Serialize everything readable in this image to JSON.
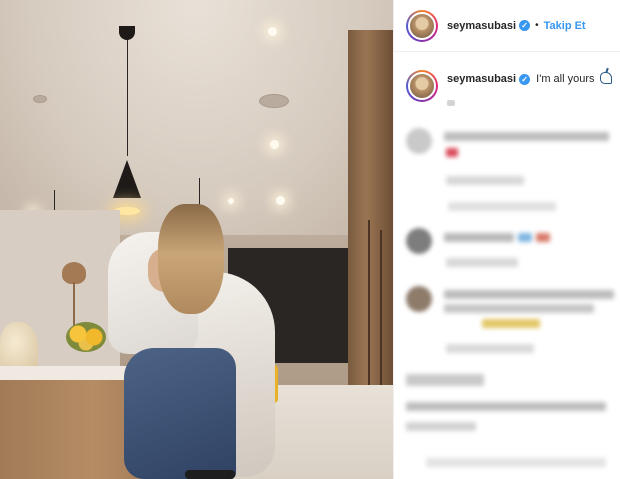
{
  "post": {
    "header": {
      "username": "seymasubasi",
      "verified_icon": "verified-badge-icon",
      "separator": "•",
      "follow_label": "Takip Et",
      "accent_color": "#3897f0"
    },
    "caption": {
      "username": "seymasubasi",
      "text": "I'm all yours",
      "emoji_icon": "unicorn-icon"
    },
    "photo": {
      "description_icon": "couple-kitchen-photo"
    },
    "comments_blurred": true
  }
}
